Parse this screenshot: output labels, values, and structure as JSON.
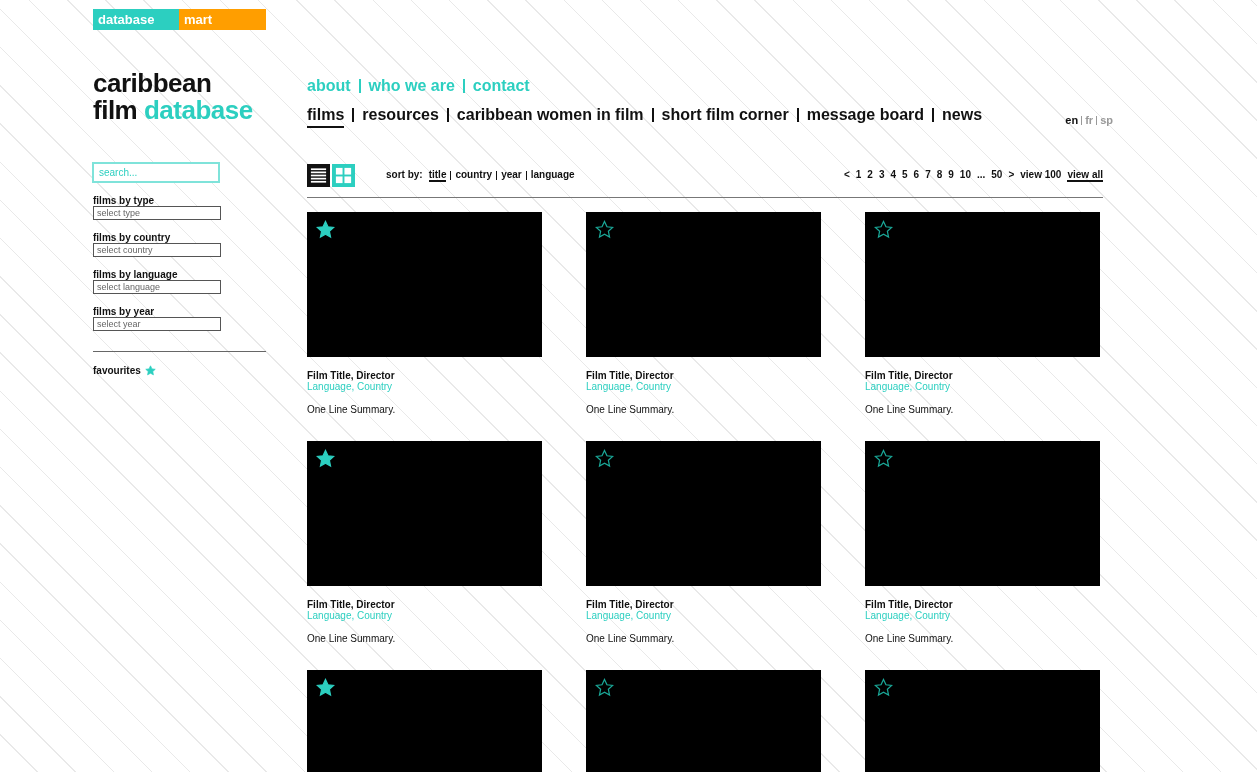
{
  "brand_tab": {
    "left": "database",
    "right": "mart"
  },
  "logo": {
    "line_1": "caribbean",
    "line_2_dark": "film",
    "line_2_accent": "database"
  },
  "search": {
    "placeholder": "search..."
  },
  "filters": [
    {
      "label": "films by type",
      "placeholder": "select type"
    },
    {
      "label": "films by country",
      "placeholder": "select country"
    },
    {
      "label": "films by language",
      "placeholder": "select language"
    },
    {
      "label": "films by year",
      "placeholder": "select year"
    }
  ],
  "favourites": {
    "label": "favourites"
  },
  "top_links": [
    "about",
    "who we are",
    "contact"
  ],
  "main_nav": [
    {
      "label": "films",
      "selected": true
    },
    {
      "label": "resources",
      "selected": false
    },
    {
      "label": "caribbean women in film",
      "selected": false
    },
    {
      "label": "short film corner",
      "selected": false
    },
    {
      "label": "message board",
      "selected": false
    },
    {
      "label": "news",
      "selected": false
    }
  ],
  "languages": [
    {
      "label": "en",
      "selected": true
    },
    {
      "label": "fr",
      "selected": false
    },
    {
      "label": "sp",
      "selected": false
    }
  ],
  "view_toggle": [
    {
      "kind": "list",
      "selected": false
    },
    {
      "kind": "grid",
      "selected": true
    }
  ],
  "sort": {
    "label": "sort by:",
    "options": [
      {
        "label": "title",
        "selected": true
      },
      {
        "label": "country",
        "selected": false
      },
      {
        "label": "year",
        "selected": false
      },
      {
        "label": "language",
        "selected": false
      }
    ]
  },
  "pagination": [
    {
      "label": "<",
      "selected": false
    },
    {
      "label": "1",
      "selected": false
    },
    {
      "label": "2",
      "selected": false
    },
    {
      "label": "3",
      "selected": false
    },
    {
      "label": "4",
      "selected": false
    },
    {
      "label": "5",
      "selected": false
    },
    {
      "label": "6",
      "selected": false
    },
    {
      "label": "7",
      "selected": false
    },
    {
      "label": "8",
      "selected": false
    },
    {
      "label": "9",
      "selected": false
    },
    {
      "label": "10",
      "selected": false
    },
    {
      "label": "...",
      "selected": false
    },
    {
      "label": "50",
      "selected": false
    },
    {
      "label": ">",
      "selected": false
    },
    {
      "label": "view 100",
      "selected": false
    },
    {
      "label": "view all",
      "selected": true
    }
  ],
  "films": [
    {
      "favourite": true,
      "title": "Film Title, Director",
      "meta": "Language, Country",
      "summary": "One Line Summary."
    },
    {
      "favourite": false,
      "title": "Film Title, Director",
      "meta": "Language, Country",
      "summary": "One Line Summary."
    },
    {
      "favourite": false,
      "title": "Film Title, Director",
      "meta": "Language, Country",
      "summary": "One Line Summary."
    },
    {
      "favourite": true,
      "title": "Film Title, Director",
      "meta": "Language, Country",
      "summary": "One Line Summary."
    },
    {
      "favourite": false,
      "title": "Film Title, Director",
      "meta": "Language, Country",
      "summary": "One Line Summary."
    },
    {
      "favourite": false,
      "title": "Film Title, Director",
      "meta": "Language, Country",
      "summary": "One Line Summary."
    },
    {
      "favourite": true
    },
    {
      "favourite": false
    },
    {
      "favourite": false
    }
  ]
}
